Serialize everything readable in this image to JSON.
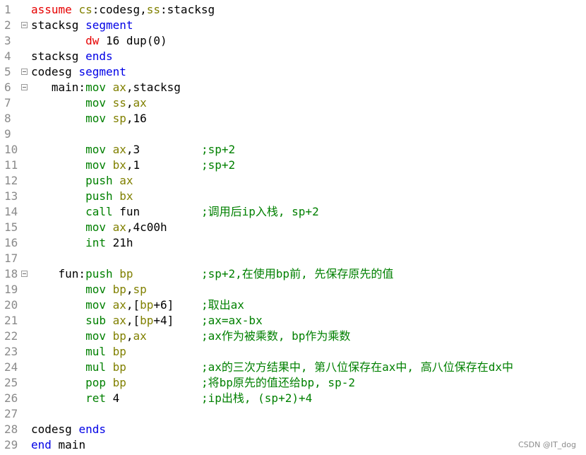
{
  "lines": [
    {
      "num": "1",
      "parts": [
        [
          "kw",
          "assume"
        ],
        [
          "plain",
          " "
        ],
        [
          "rg",
          "cs"
        ],
        [
          "plain",
          ":codesg,"
        ],
        [
          "rg",
          "ss"
        ],
        [
          "plain",
          ":stacksg"
        ]
      ],
      "fold": false,
      "comment": ""
    },
    {
      "num": "2",
      "parts": [
        [
          "plain",
          "stacksg "
        ],
        [
          "seg",
          "segment"
        ]
      ],
      "fold": true,
      "comment": ""
    },
    {
      "num": "3",
      "parts": [
        [
          "plain",
          "        "
        ],
        [
          "kw",
          "dw"
        ],
        [
          "plain",
          " 16 dup(0)"
        ]
      ],
      "fold": false,
      "comment": ""
    },
    {
      "num": "4",
      "parts": [
        [
          "plain",
          "stacksg "
        ],
        [
          "seg",
          "ends"
        ]
      ],
      "fold": false,
      "comment": ""
    },
    {
      "num": "5",
      "parts": [
        [
          "plain",
          "codesg "
        ],
        [
          "seg",
          "segment"
        ]
      ],
      "fold": true,
      "comment": ""
    },
    {
      "num": "6",
      "parts": [
        [
          "plain",
          "   main:"
        ],
        [
          "mn",
          "mov"
        ],
        [
          "plain",
          " "
        ],
        [
          "rg",
          "ax"
        ],
        [
          "plain",
          ",stacksg"
        ]
      ],
      "fold": true,
      "comment": ""
    },
    {
      "num": "7",
      "parts": [
        [
          "plain",
          "        "
        ],
        [
          "mn",
          "mov"
        ],
        [
          "plain",
          " "
        ],
        [
          "rg",
          "ss"
        ],
        [
          "plain",
          ","
        ],
        [
          "rg",
          "ax"
        ]
      ],
      "fold": false,
      "comment": ""
    },
    {
      "num": "8",
      "parts": [
        [
          "plain",
          "        "
        ],
        [
          "mn",
          "mov"
        ],
        [
          "plain",
          " "
        ],
        [
          "rg",
          "sp"
        ],
        [
          "plain",
          ",16"
        ]
      ],
      "fold": false,
      "comment": ""
    },
    {
      "num": "9",
      "parts": [],
      "fold": false,
      "comment": ""
    },
    {
      "num": "10",
      "parts": [
        [
          "plain",
          "        "
        ],
        [
          "mn",
          "mov"
        ],
        [
          "plain",
          " "
        ],
        [
          "rg",
          "ax"
        ],
        [
          "plain",
          ",3"
        ]
      ],
      "fold": false,
      "comment": ";sp+2"
    },
    {
      "num": "11",
      "parts": [
        [
          "plain",
          "        "
        ],
        [
          "mn",
          "mov"
        ],
        [
          "plain",
          " "
        ],
        [
          "rg",
          "bx"
        ],
        [
          "plain",
          ",1"
        ]
      ],
      "fold": false,
      "comment": ";sp+2"
    },
    {
      "num": "12",
      "parts": [
        [
          "plain",
          "        "
        ],
        [
          "mn",
          "push"
        ],
        [
          "plain",
          " "
        ],
        [
          "rg",
          "ax"
        ]
      ],
      "fold": false,
      "comment": ""
    },
    {
      "num": "13",
      "parts": [
        [
          "plain",
          "        "
        ],
        [
          "mn",
          "push"
        ],
        [
          "plain",
          " "
        ],
        [
          "rg",
          "bx"
        ]
      ],
      "fold": false,
      "comment": ""
    },
    {
      "num": "14",
      "parts": [
        [
          "plain",
          "        "
        ],
        [
          "mn",
          "call"
        ],
        [
          "plain",
          " fun"
        ]
      ],
      "fold": false,
      "comment": ";调用后ip入栈, sp+2"
    },
    {
      "num": "15",
      "parts": [
        [
          "plain",
          "        "
        ],
        [
          "mn",
          "mov"
        ],
        [
          "plain",
          " "
        ],
        [
          "rg",
          "ax"
        ],
        [
          "plain",
          ",4c00h"
        ]
      ],
      "fold": false,
      "comment": ""
    },
    {
      "num": "16",
      "parts": [
        [
          "plain",
          "        "
        ],
        [
          "mn",
          "int"
        ],
        [
          "plain",
          " 21h"
        ]
      ],
      "fold": false,
      "comment": ""
    },
    {
      "num": "17",
      "parts": [],
      "fold": false,
      "comment": ""
    },
    {
      "num": "18",
      "parts": [
        [
          "plain",
          "    fun:"
        ],
        [
          "mn",
          "push"
        ],
        [
          "plain",
          " "
        ],
        [
          "rg",
          "bp"
        ]
      ],
      "fold": true,
      "comment": ";sp+2,在使用bp前, 先保存原先的值"
    },
    {
      "num": "19",
      "parts": [
        [
          "plain",
          "        "
        ],
        [
          "mn",
          "mov"
        ],
        [
          "plain",
          " "
        ],
        [
          "rg",
          "bp"
        ],
        [
          "plain",
          ","
        ],
        [
          "rg",
          "sp"
        ]
      ],
      "fold": false,
      "comment": ""
    },
    {
      "num": "20",
      "parts": [
        [
          "plain",
          "        "
        ],
        [
          "mn",
          "mov"
        ],
        [
          "plain",
          " "
        ],
        [
          "rg",
          "ax"
        ],
        [
          "plain",
          ",["
        ],
        [
          "rg",
          "bp"
        ],
        [
          "plain",
          "+6]"
        ]
      ],
      "fold": false,
      "comment": ";取出ax"
    },
    {
      "num": "21",
      "parts": [
        [
          "plain",
          "        "
        ],
        [
          "mn",
          "sub"
        ],
        [
          "plain",
          " "
        ],
        [
          "rg",
          "ax"
        ],
        [
          "plain",
          ",["
        ],
        [
          "rg",
          "bp"
        ],
        [
          "plain",
          "+4]"
        ]
      ],
      "fold": false,
      "comment": ";ax=ax-bx"
    },
    {
      "num": "22",
      "parts": [
        [
          "plain",
          "        "
        ],
        [
          "mn",
          "mov"
        ],
        [
          "plain",
          " "
        ],
        [
          "rg",
          "bp"
        ],
        [
          "plain",
          ","
        ],
        [
          "rg",
          "ax"
        ]
      ],
      "fold": false,
      "comment": ";ax作为被乘数, bp作为乘数"
    },
    {
      "num": "23",
      "parts": [
        [
          "plain",
          "        "
        ],
        [
          "mn",
          "mul"
        ],
        [
          "plain",
          " "
        ],
        [
          "rg",
          "bp"
        ]
      ],
      "fold": false,
      "comment": ""
    },
    {
      "num": "24",
      "parts": [
        [
          "plain",
          "        "
        ],
        [
          "mn",
          "mul"
        ],
        [
          "plain",
          " "
        ],
        [
          "rg",
          "bp"
        ]
      ],
      "fold": false,
      "comment": ";ax的三次方结果中, 第八位保存在ax中, 高八位保存在dx中"
    },
    {
      "num": "25",
      "parts": [
        [
          "plain",
          "        "
        ],
        [
          "mn",
          "pop"
        ],
        [
          "plain",
          " "
        ],
        [
          "rg",
          "bp"
        ]
      ],
      "fold": false,
      "comment": ";将bp原先的值还给bp, sp-2"
    },
    {
      "num": "26",
      "parts": [
        [
          "plain",
          "        "
        ],
        [
          "mn",
          "ret"
        ],
        [
          "plain",
          " 4"
        ]
      ],
      "fold": false,
      "comment": ";ip出栈, (sp+2)+4"
    },
    {
      "num": "27",
      "parts": [],
      "fold": false,
      "comment": ""
    },
    {
      "num": "28",
      "parts": [
        [
          "plain",
          "codesg "
        ],
        [
          "seg",
          "ends"
        ]
      ],
      "fold": false,
      "comment": ""
    },
    {
      "num": "29",
      "parts": [
        [
          "seg",
          "end"
        ],
        [
          "plain",
          " main"
        ]
      ],
      "fold": false,
      "comment": ""
    }
  ],
  "watermark": "CSDN @IT_dog",
  "colors": {
    "directive": "#e60000",
    "segment_keyword": "#0000e6",
    "mnemonic": "#008000",
    "register": "#808000",
    "comment": "#008000",
    "line_number": "#8a8a8a"
  }
}
